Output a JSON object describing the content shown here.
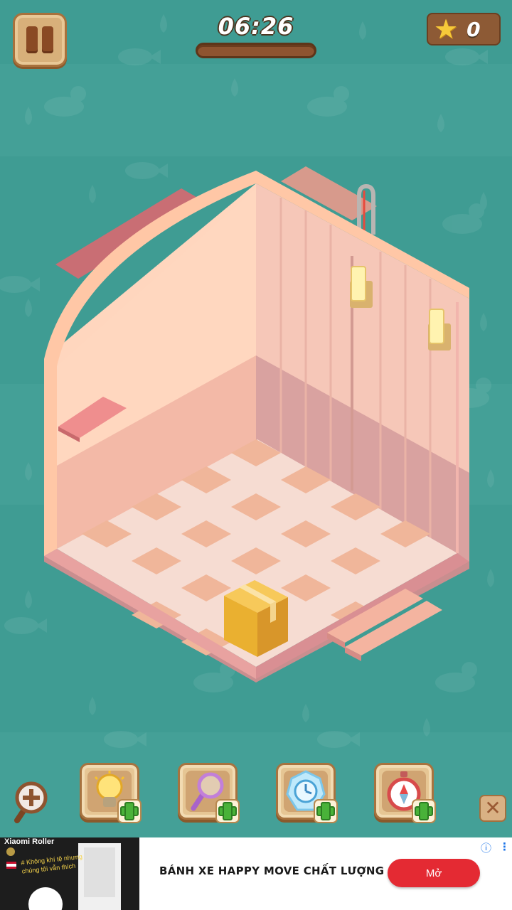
{
  "hud": {
    "timer": "06:26",
    "stars": "0"
  },
  "toolbar": {
    "tools": [
      {
        "name": "hint",
        "icon": "lightbulb-icon"
      },
      {
        "name": "magnifier",
        "icon": "magnifier-icon"
      },
      {
        "name": "freeze-time",
        "icon": "frozen-clock-icon"
      },
      {
        "name": "compass",
        "icon": "compass-icon"
      }
    ],
    "zoom_icon": "zoom-in-icon",
    "close_icon": "close-icon"
  },
  "ad": {
    "thumb_title": "Xiaomi Roller",
    "thumb_caption": "# Không khí tệ nhưng chúng tôi vẫn thích",
    "headline": "BÁNH XE HAPPY MOVE CHẤT LƯỢNG",
    "cta": "Mở"
  },
  "colors": {
    "background": "#3f9c93",
    "wall_left": "#ffd7bf",
    "wall_right": "#f4c1b3",
    "floor_light": "#f6dcd2",
    "floor_dark": "#f0b69a",
    "box": "#f2b73c",
    "cta": "#e42a33"
  }
}
